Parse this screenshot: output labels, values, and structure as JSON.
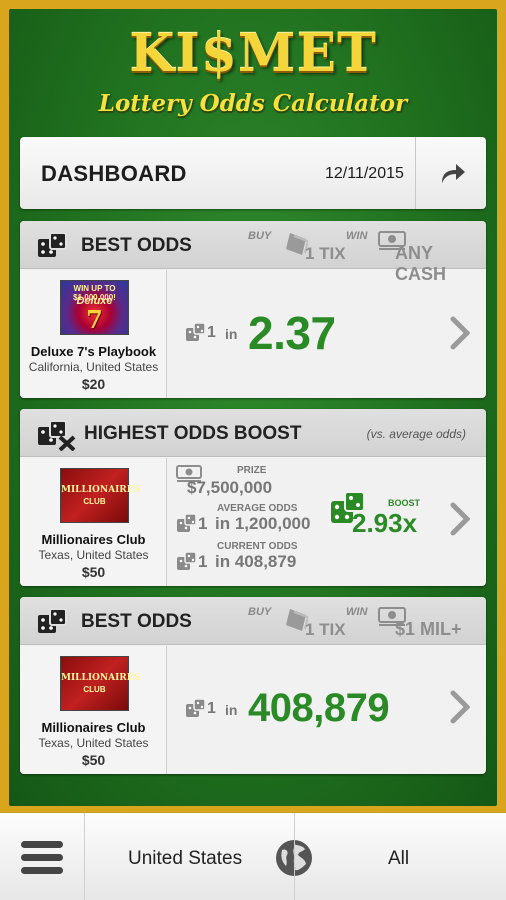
{
  "logo": {
    "title": "KI$MET",
    "subtitle": "Lottery Odds Calculator"
  },
  "dashboard": {
    "title": "DASHBOARD",
    "date": "12/11/2015",
    "share_icon": "share-arrow-icon"
  },
  "cards": [
    {
      "header": {
        "title": "BEST ODDS",
        "buy_label": "BUY",
        "buy_value": "1 TIX",
        "win_label": "WIN",
        "win_value": "ANY CASH"
      },
      "ticket": {
        "image_text": "WIN UP TO $1,000,000!",
        "image_title": "Deluxe",
        "image_number": "7",
        "name": "Deluxe 7's Playbook",
        "location": "California, United States",
        "price": "$20"
      },
      "odds": {
        "one": "1",
        "in": "in",
        "value": "2.37"
      }
    },
    {
      "header": {
        "title": "HIGHEST ODDS BOOST",
        "note": "(vs. average odds)"
      },
      "ticket": {
        "image_title": "MILLIONAIRES",
        "image_sub": "CLUB",
        "name": "Millionaires Club",
        "location": "Texas, United States",
        "price": "$50"
      },
      "stats": {
        "prize_label": "PRIZE",
        "prize_value": "$7,500,000",
        "avg_label": "AVERAGE ODDS",
        "avg_one": "1",
        "avg_value": "in 1,200,000",
        "cur_label": "CURRENT ODDS",
        "cur_one": "1",
        "cur_value": "in 408,879",
        "boost_label": "BOOST",
        "boost_value": "2.93x"
      }
    },
    {
      "header": {
        "title": "BEST ODDS",
        "buy_label": "BUY",
        "buy_value": "1 TIX",
        "win_label": "WIN",
        "win_value": "$1 MIL+"
      },
      "ticket": {
        "image_title": "MILLIONAIRES",
        "image_sub": "CLUB",
        "name": "Millionaires Club",
        "location": "Texas, United States",
        "price": "$50"
      },
      "odds": {
        "one": "1",
        "in": "in",
        "value": "408,879"
      }
    }
  ],
  "bottom_bar": {
    "menu_icon": "hamburger-menu-icon",
    "country": "United States",
    "globe_icon": "globe-icon",
    "filter": "All"
  },
  "colors": {
    "frame_gold": "#d8a51c",
    "felt_green": "#20701f",
    "odds_green": "#2a8a25",
    "logo_gold": "#f4d63a"
  }
}
